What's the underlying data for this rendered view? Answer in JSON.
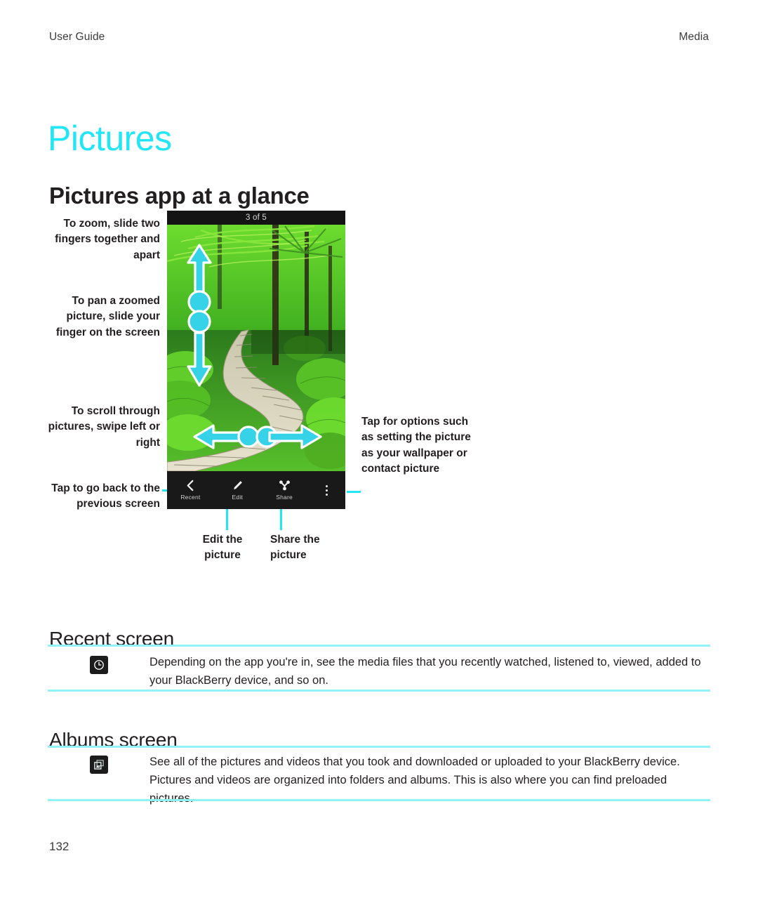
{
  "header": {
    "left": "User Guide",
    "right": "Media"
  },
  "chapter_title": "Pictures",
  "section_title": "Pictures app at a glance",
  "figure": {
    "device": {
      "counter": "3 of 5",
      "toolbar": [
        {
          "icon": "chevron-left-icon",
          "label": "Recent"
        },
        {
          "icon": "pencil-icon",
          "label": "Edit"
        },
        {
          "icon": "share-icon",
          "label": "Share"
        }
      ],
      "overflow_icon": "overflow-dots-icon"
    },
    "callouts": {
      "zoom": "To zoom, slide two fingers together and apart",
      "pan": "To pan a zoomed picture, slide your finger on the screen",
      "scroll": "To scroll through pictures, swipe left or right",
      "back": "Tap to go back to the previous screen",
      "options": "Tap for options such as setting the picture as your wallpaper or contact picture",
      "edit": "Edit the picture",
      "share": "Share the picture"
    }
  },
  "sections": [
    {
      "title": "Recent screen",
      "icon": "clock-icon",
      "text": "Depending on the app you're in, see the media files that you recently watched, listened to, viewed, added to your BlackBerry device, and so on."
    },
    {
      "title": "Albums screen",
      "icon": "albums-stack-icon",
      "text": "See all of the pictures and videos that you took and downloaded or uploaded to your BlackBerry device. Pictures and videos are organized into folders and albums. This is also where you can find preloaded pictures."
    }
  ],
  "page_number": "132",
  "colors": {
    "accent": "#22E6F5",
    "rule": "#8FF3F7",
    "text": "#231f20"
  }
}
